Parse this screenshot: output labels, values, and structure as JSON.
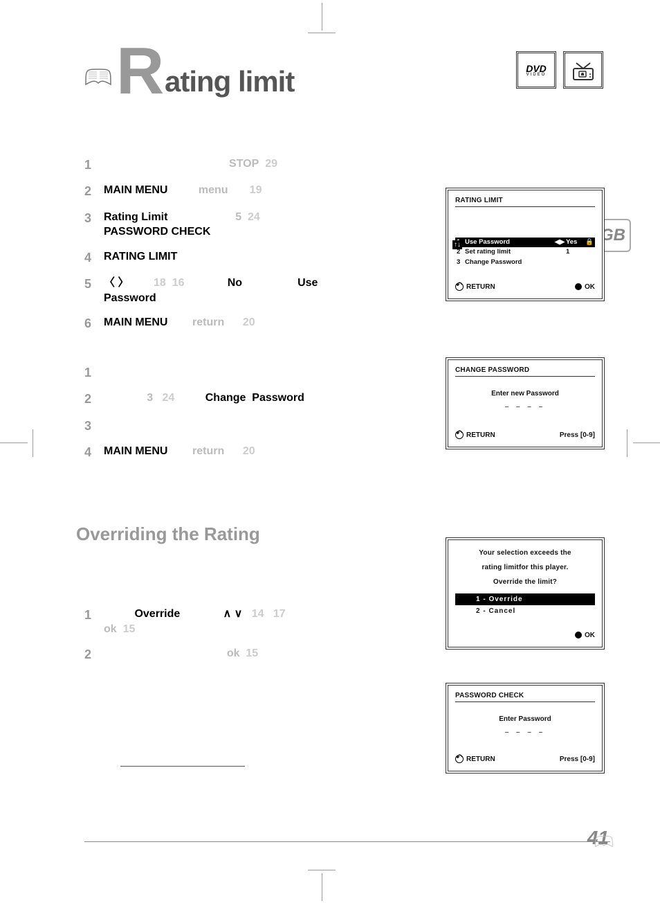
{
  "header": {
    "title_initial": "R",
    "title_rest": "ating limit",
    "dvd_label": "DVD",
    "dvd_sub": "VIDEO",
    "gb_label": "GB"
  },
  "section1_steps": [
    {
      "num": "1",
      "segments": [
        {
          "t": "STOP",
          "cls": "ghost"
        },
        {
          "t": "  29",
          "cls": "ghost-num"
        }
      ],
      "align": "center-line"
    },
    {
      "num": "2",
      "segments": [
        {
          "t": "MAIN MENU",
          "cls": "bold"
        },
        {
          "t": "          "
        },
        {
          "t": "menu",
          "cls": "ghost"
        },
        {
          "t": "       19",
          "cls": "ghost-num"
        }
      ]
    },
    {
      "num": "3",
      "segments": [
        {
          "t": "Rating Limit",
          "cls": "bold"
        },
        {
          "t": "                      "
        },
        {
          "t": "5",
          "cls": "ghost"
        },
        {
          "t": "  24",
          "cls": "ghost-num"
        }
      ],
      "line2": [
        {
          "t": "PASSWORD CHECK",
          "cls": "bold"
        }
      ]
    },
    {
      "num": "4",
      "segments": [],
      "line2": [
        {
          "t": "RATING LIMIT",
          "cls": "bold"
        }
      ]
    },
    {
      "num": "5",
      "segments": [
        {
          "t": "〈 〉",
          "cls": "bold"
        },
        {
          "t": "        18  16",
          "cls": "ghost-num"
        },
        {
          "t": "              "
        },
        {
          "t": "No",
          "cls": "bold"
        },
        {
          "t": "                  "
        },
        {
          "t": "Use",
          "cls": "bold"
        }
      ],
      "line2": [
        {
          "t": "Password",
          "cls": "bold"
        }
      ]
    },
    {
      "num": "6",
      "segments": [
        {
          "t": "MAIN MENU",
          "cls": "bold"
        },
        {
          "t": "        "
        },
        {
          "t": "return",
          "cls": "ghost"
        },
        {
          "t": "      20",
          "cls": "ghost-num"
        }
      ]
    }
  ],
  "section2_steps": [
    {
      "num": "1",
      "segments": []
    },
    {
      "num": "2",
      "segments": [
        {
          "t": "              3",
          "cls": "ghost"
        },
        {
          "t": "   24",
          "cls": "ghost-num"
        },
        {
          "t": "          "
        },
        {
          "t": "Change  Password",
          "cls": "bold"
        }
      ]
    },
    {
      "num": "3",
      "segments": []
    },
    {
      "num": "4",
      "segments": [
        {
          "t": "MAIN MENU",
          "cls": "bold"
        },
        {
          "t": "        "
        },
        {
          "t": "return",
          "cls": "ghost"
        },
        {
          "t": "      20",
          "cls": "ghost-num"
        }
      ]
    }
  ],
  "override_heading": "Overriding the Rating",
  "section3_steps": [
    {
      "num": "1",
      "segments": [
        {
          "t": "          "
        },
        {
          "t": "Override",
          "cls": "bold"
        },
        {
          "t": "              ∧ ∨",
          "cls": "bold"
        },
        {
          "t": "   14   17",
          "cls": "ghost-num"
        }
      ],
      "line2": [
        {
          "t": "ok",
          "cls": "ghost"
        },
        {
          "t": "  15",
          "cls": "ghost-num"
        }
      ]
    },
    {
      "num": "2",
      "segments": [
        {
          "t": "                                        "
        },
        {
          "t": "ok",
          "cls": "ghost"
        },
        {
          "t": "  15",
          "cls": "ghost-num"
        }
      ]
    }
  ],
  "osd1": {
    "title": "RATING LIMIT",
    "rows": [
      {
        "num": "1",
        "label": "Use Password",
        "arrows": "◀▶",
        "value": "Yes",
        "lock": "🔒",
        "hl": true
      },
      {
        "num": "2",
        "label": "Set rating limit",
        "arrows": "",
        "value": "1",
        "lock": "",
        "hl": false
      },
      {
        "num": "3",
        "label": "Change Password",
        "arrows": "",
        "value": "",
        "lock": "",
        "hl": false
      }
    ],
    "return": "RETURN",
    "ok": "OK"
  },
  "osd2": {
    "title": "CHANGE PASSWORD",
    "prompt": "Enter new Password",
    "dashes": "– – – –",
    "return": "RETURN",
    "press": "Press [0-9]"
  },
  "osd3": {
    "line1": "Your selection exceeds the",
    "line2": "rating limitfor this player.",
    "line3": "Override the limit?",
    "opt1": "1 - Override",
    "opt2": "2 - Cancel",
    "ok": "OK"
  },
  "osd4": {
    "title": "PASSWORD CHECK",
    "prompt": "Enter Password",
    "dashes": "– – – –",
    "return": "RETURN",
    "press": "Press [0-9]"
  },
  "page_number": "41"
}
